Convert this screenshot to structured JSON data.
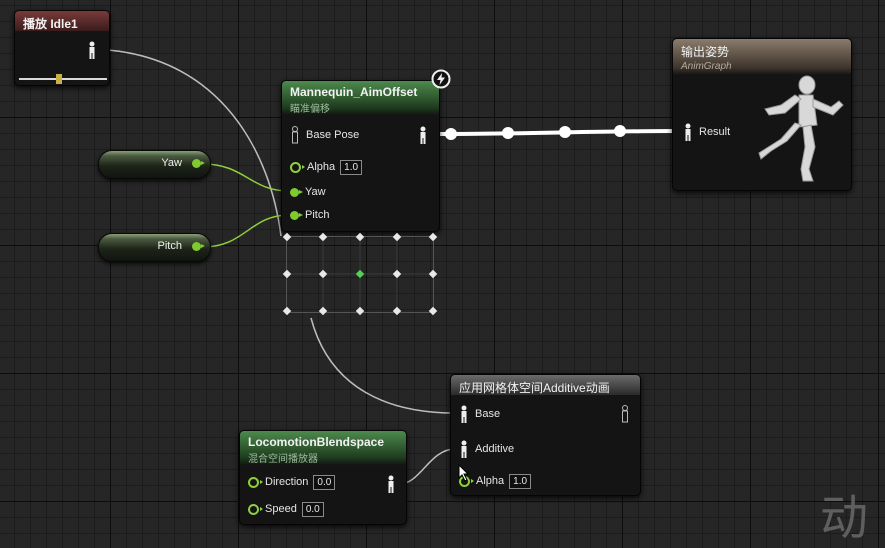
{
  "nodes": {
    "play_idle": {
      "title": "播放 Idle1",
      "slider_value": 0.45
    },
    "aim_offset": {
      "title": "Mannequin_AimOffset",
      "subtitle": "瞄准偏移",
      "base_pose_label": "Base Pose",
      "alpha_label": "Alpha",
      "alpha_value": "1.0",
      "yaw_label": "Yaw",
      "pitch_label": "Pitch"
    },
    "output_pose": {
      "title": "输出姿势",
      "subtitle": "AnimGraph",
      "result_label": "Result"
    },
    "apply_additive": {
      "title": "应用网格体空间Additive动画",
      "base_label": "Base",
      "additive_label": "Additive",
      "alpha_label": "Alpha",
      "alpha_value": "1.0"
    },
    "locomotion": {
      "title": "LocomotionBlendspace",
      "subtitle": "混合空间播放器",
      "direction_label": "Direction",
      "direction_value": "0.0",
      "speed_label": "Speed",
      "speed_value": "0.0"
    }
  },
  "variables": {
    "yaw": "Yaw",
    "pitch": "Pitch"
  },
  "icons": [
    "lightning-icon",
    "pose-pin-icon",
    "running-mannequin-icon"
  ],
  "colors": {
    "float_pin": "#7fcb2e",
    "pose_wire": "#ffffff",
    "accent_header_green": "#3d6b3d",
    "accent_header_red": "#6b3030"
  },
  "watermark": "动"
}
